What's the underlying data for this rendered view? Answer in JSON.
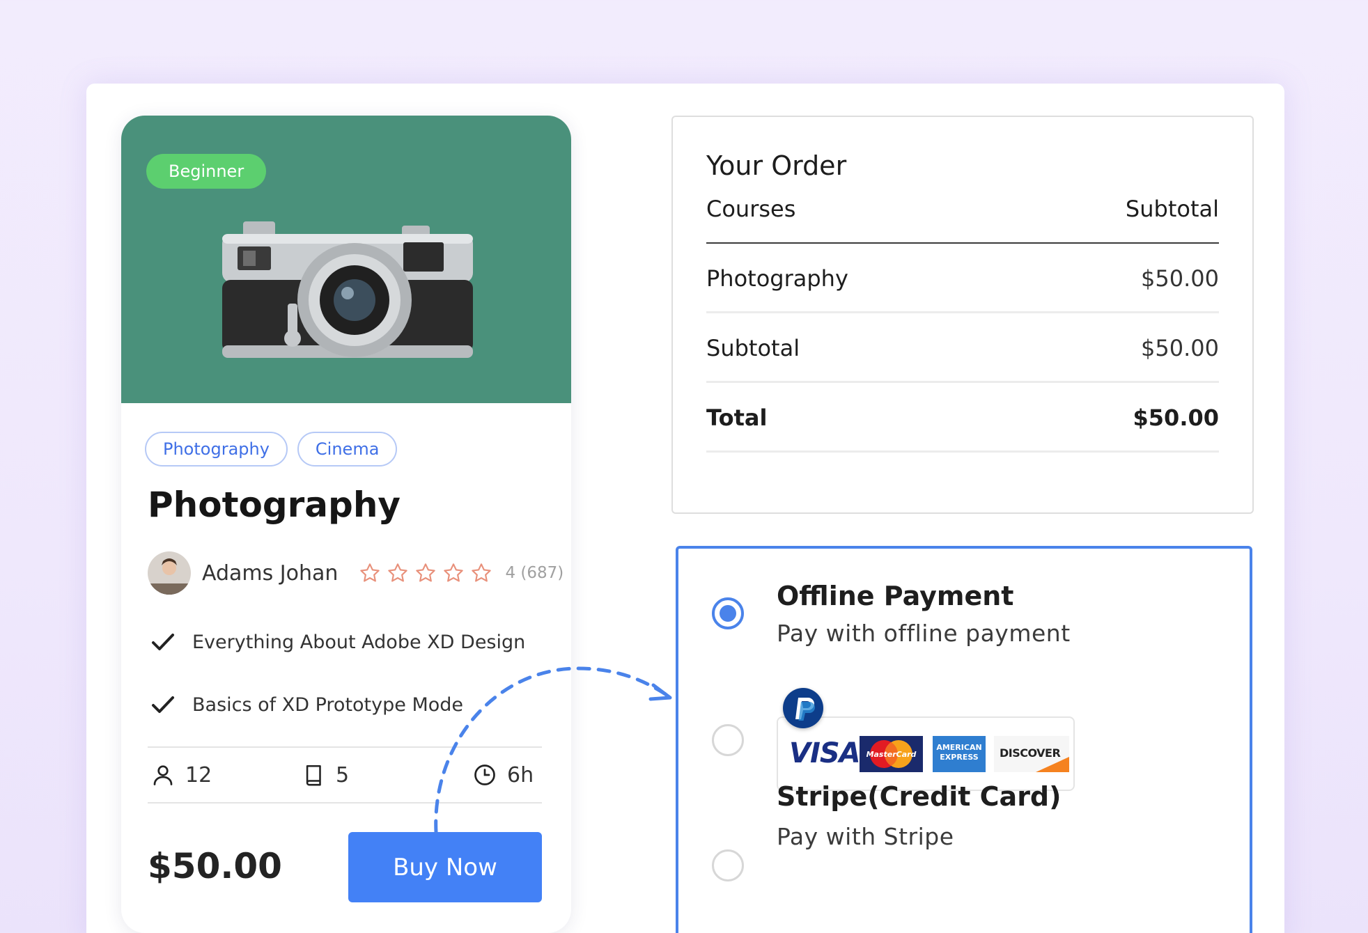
{
  "course": {
    "level_badge": "Beginner",
    "tags": [
      "Photography",
      "Cinema"
    ],
    "title": "Photography",
    "author": "Adams Johan",
    "rating_text": "4 (687)",
    "rating": 4,
    "rating_max": 5,
    "features": [
      "Everything About Adobe XD Design",
      "Basics of XD Prototype Mode"
    ],
    "stats": {
      "students": "12",
      "lessons": "5",
      "duration": "6h"
    },
    "price": "$50.00",
    "buy_label": "Buy Now",
    "icons": [
      "check-icon",
      "user-icon",
      "book-icon",
      "clock-icon",
      "star-icon"
    ]
  },
  "order": {
    "title": "Your Order",
    "col_courses": "Courses",
    "col_subtotal": "Subtotal",
    "rows": [
      {
        "label": "Photography",
        "amount": "$50.00"
      },
      {
        "label": "Subtotal",
        "amount": "$50.00"
      },
      {
        "label": "Total",
        "amount": "$50.00"
      }
    ]
  },
  "payment": {
    "options": [
      {
        "title": "Offline Payment",
        "subtitle": "Pay with offline payment",
        "selected": true
      },
      {
        "title": "",
        "subtitle": "",
        "selected": false
      },
      {
        "title": "Stripe(Credit Card)",
        "subtitle": "Pay with Stripe",
        "selected": false
      }
    ],
    "card_logos": {
      "visa": "VISA",
      "mastercard": "MasterCard",
      "amex_line1": "AMERICAN",
      "amex_line2": "EXPRESS",
      "discover": "DISCOVER"
    }
  },
  "colors": {
    "accent": "#4381f6",
    "hero_bg": "#4a917b",
    "badge_green": "#5ccf6f",
    "star": "#e8907a"
  }
}
